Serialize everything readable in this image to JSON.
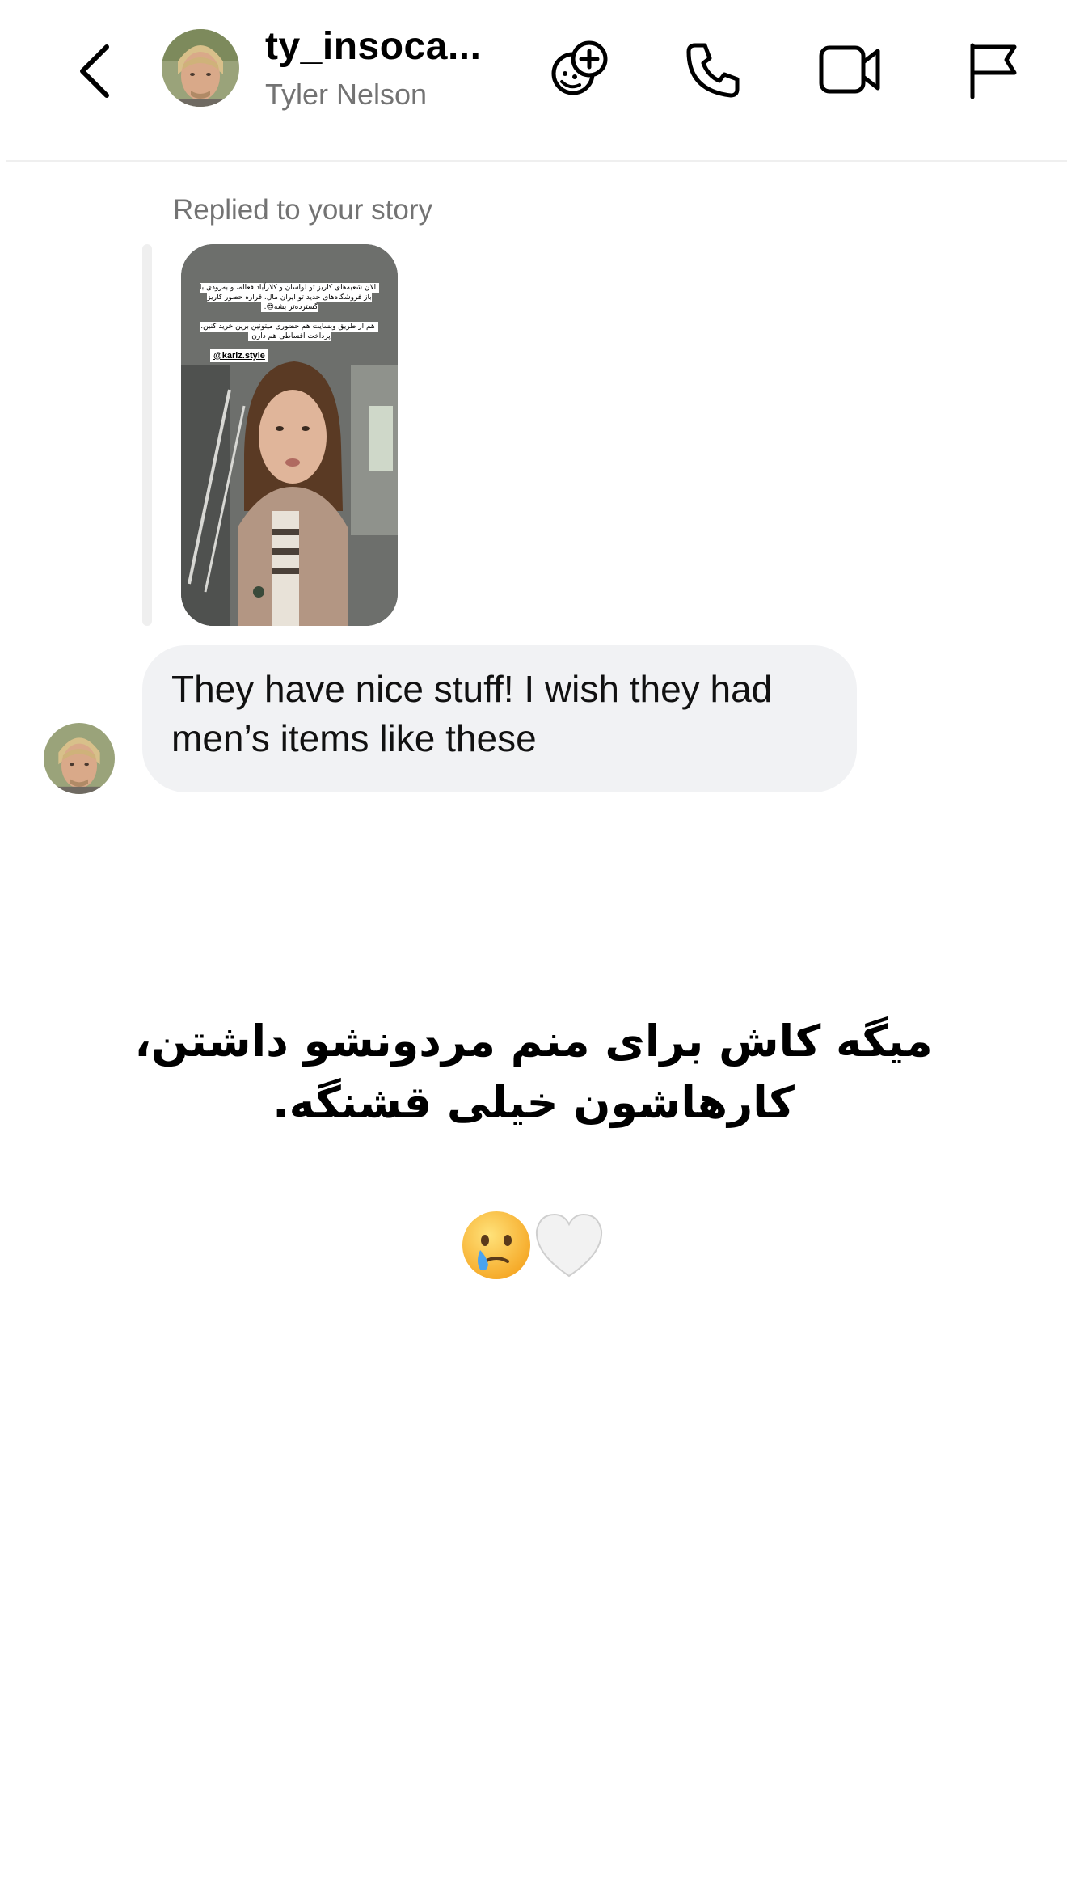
{
  "header": {
    "username": "ty_insoca...",
    "display_name": "Tyler Nelson",
    "icons": [
      "back-chevron-icon",
      "effects-icon",
      "phone-icon",
      "video-icon",
      "flag-icon"
    ]
  },
  "thread": {
    "reply_context": "Replied to your story",
    "story": {
      "caption_line1": "الان شعبه‌های کاریز تو لواسان و کلارآباد فعاله، و به‌زودی با باز فروشگاه‌های جدید تو ایران مال، قراره حضور کاریز گسترده‌تر بشه😍.",
      "caption_line2": "هم از طریق وبسایت هم حضوری میتونین برین خرید کنین. پرداخت اقساطی هم دارن",
      "tag": "@kariz.style"
    },
    "message": "They have nice stuff! I wish they had men’s items like these"
  },
  "overlay_caption": "میگه کاش برای منم مردونشو داشتن، کارهاشون خیلی قشنگه.",
  "emojis": [
    "face-holding-back-tears",
    "white-heart"
  ],
  "colors": {
    "bubble": "#f1f2f4",
    "secondary_text": "#737373",
    "divider": "#efefef"
  }
}
